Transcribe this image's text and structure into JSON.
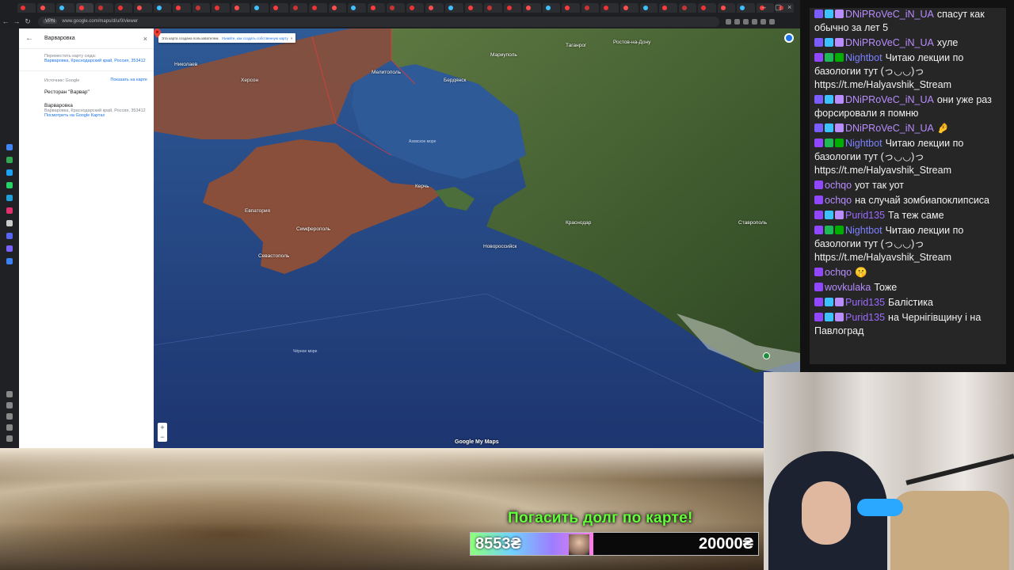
{
  "browser": {
    "url": "www.google.com/maps/d/u/0/viewer",
    "site_pill": "VPN",
    "tab_count": 40,
    "back_label": "←",
    "forward_label": "→",
    "reload_label": "↻"
  },
  "maps_panel": {
    "title": "Варваровка",
    "back": "←",
    "close": "×",
    "move_label": "Переместить карту сюда:",
    "move_link": "Варваровка, Краснодарский край, Россия, 353412",
    "source_label": "Источник: Google",
    "show_on_map": "Показать на карте",
    "result_1": "Ресторан \"Варвар\"",
    "result_2_title": "Варваровка",
    "result_2_addr": "Варваровка, Краснодарский край, Россия, 353412",
    "result_2_link": "Посмотреть на Google Картах"
  },
  "map": {
    "notice_text": "Эта карта создана пользователем.",
    "notice_link": "Узнайте, как создать собственную карту",
    "notice_close": "×",
    "brand": "Google My Maps",
    "zoom_in": "+",
    "zoom_out": "−",
    "labels": {
      "nikolaev": "Николаев",
      "melitopol": "Мелитополь",
      "berdyansk": "Бердянск",
      "mariupol": "Мариуполь",
      "taganrog": "Таганрог",
      "rostov": "Ростов-на-Дону",
      "kherson": "Херсон",
      "evpatoria": "Евпатория",
      "simferopol": "Симферополь",
      "sevastopol": "Севастополь",
      "kerch": "Керчь",
      "novorossiysk": "Новороссийск",
      "krasnodar": "Краснодар",
      "stavropol": "Ставрополь",
      "azov_sea": "Азовское море",
      "black_sea": "Чёрное море"
    }
  },
  "donation": {
    "title": "Погасить долг по карте!",
    "current": "8553₴",
    "goal": "20000₴",
    "progress_percent": 42.8
  },
  "chat": [
    {
      "user": "DNiPRoVeC_iN_UA",
      "color": "#b98cff",
      "text": "спасут как обычно за лет 5",
      "badges": [
        "#7a5cff",
        "#3ec1ff",
        "#b98cff"
      ]
    },
    {
      "user": "DNiPRoVeC_iN_UA",
      "color": "#b98cff",
      "text": "хуле",
      "badges": [
        "#7a5cff",
        "#3ec1ff",
        "#b98cff"
      ]
    },
    {
      "user": "Nightbot",
      "color": "#7b82ff",
      "text": "Читаю лекции по базологии тут (っ◡◡)っ https://t.me/Halyavshik_Stream",
      "badges": [
        "#9146ff",
        "#1db954",
        "#00ad03"
      ]
    },
    {
      "user": "DNiPRoVeC_iN_UA",
      "color": "#b98cff",
      "text": "они уже раз форсировали я помню",
      "badges": [
        "#7a5cff",
        "#3ec1ff",
        "#b98cff"
      ]
    },
    {
      "user": "DNiPRoVeC_iN_UA",
      "color": "#b98cff",
      "text": "🤌",
      "badges": [
        "#7a5cff",
        "#3ec1ff",
        "#b98cff"
      ]
    },
    {
      "user": "Nightbot",
      "color": "#7b82ff",
      "text": "Читаю лекции по базологии тут (っ◡◡)っ https://t.me/Halyavshik_Stream",
      "badges": [
        "#9146ff",
        "#1db954",
        "#00ad03"
      ]
    },
    {
      "user": "ochqo",
      "color": "#b58cff",
      "text": "уот так уот",
      "badges": [
        "#9146ff"
      ]
    },
    {
      "user": "ochqo",
      "color": "#b58cff",
      "text": "на случай зомбиапоклипсиса",
      "badges": [
        "#9146ff"
      ]
    },
    {
      "user": "Purid135",
      "color": "#9b6bff",
      "text": "Та теж саме",
      "badges": [
        "#9146ff",
        "#3ec1ff",
        "#b98cff"
      ]
    },
    {
      "user": "Nightbot",
      "color": "#7b82ff",
      "text": "Читаю лекции по базологии тут (っ◡◡)っ https://t.me/Halyavshik_Stream",
      "badges": [
        "#9146ff",
        "#1db954",
        "#00ad03"
      ]
    },
    {
      "user": "ochqo",
      "color": "#b58cff",
      "text": "🤫",
      "badges": [
        "#9146ff"
      ]
    },
    {
      "user": "wovkulaka",
      "color": "#b58cff",
      "text": "Тоже",
      "badges": [
        "#9146ff"
      ]
    },
    {
      "user": "Purid135",
      "color": "#9b6bff",
      "text": "Балістика",
      "badges": [
        "#9146ff",
        "#3ec1ff",
        "#b98cff"
      ]
    },
    {
      "user": "Purid135",
      "color": "#9b6bff",
      "text": "на Чернігівщину і на Павлоград",
      "badges": [
        "#9146ff",
        "#3ec1ff",
        "#b98cff"
      ]
    }
  ],
  "colors": {
    "sea": "#233f7a",
    "occupied": "#8a4f3a",
    "land": "#4e6b3a",
    "accent": "#62ff3a"
  }
}
